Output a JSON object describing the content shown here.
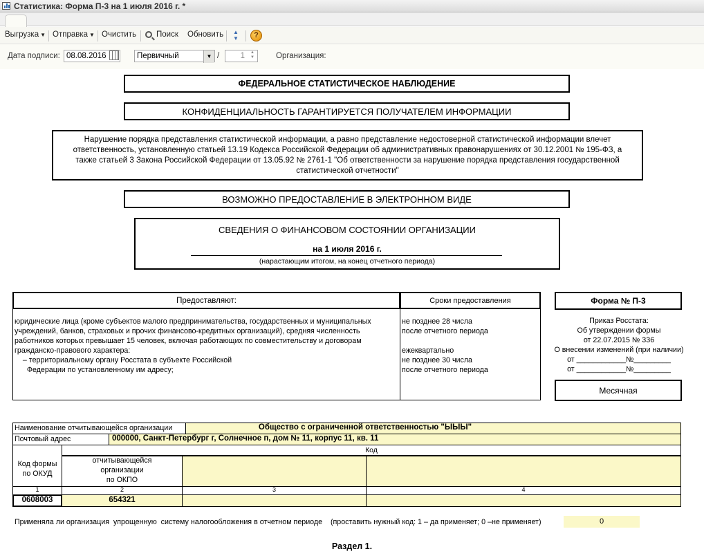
{
  "window": {
    "title": "Статистика: Форма П-3 на 1 июля 2016 г. *"
  },
  "toolbar": {
    "export_label": "Выгрузка",
    "send_label": "Отправка",
    "clear_label": "Очистить",
    "search_label": "Поиск",
    "refresh_label": "Обновить",
    "help_label": "?"
  },
  "params": {
    "sign_date_label": "Дата подписи:",
    "sign_date_value": "08.08.2016",
    "report_type_value": "Первичный",
    "slash": "/",
    "correction_number": "1",
    "organization_label": "Организация:"
  },
  "header": {
    "federal": "ФЕДЕРАЛЬНОЕ СТАТИСТИЧЕСКОЕ НАБЛЮДЕНИЕ",
    "confidential": "КОНФИДЕНЦИАЛЬНОСТЬ ГАРАНТИРУЕТСЯ ПОЛУЧАТЕЛЕМ ИНФОРМАЦИИ",
    "warning_lines": [
      "Нарушение порядка представления статистической информации, а равно представление недостоверной статистической информации влечет",
      "ответственность, установленную статьей 13.19 Кодекса Российской Федерации об административных правонарушениях от 30.12.2001 № 195-ФЗ, а",
      "также статьей 3 Закона Российской Федерации от 13.05.92 № 2761-1 \"Об ответственности за нарушение порядка представления государственной",
      "статистической отчетности\""
    ],
    "electronic": "ВОЗМОЖНО ПРЕДОСТАВЛЕНИЕ В ЭЛЕКТРОННОМ ВИДЕ",
    "report_title": "СВЕДЕНИЯ О ФИНАНСОВОМ СОСТОЯНИИ ОРГАНИЗАЦИИ",
    "report_date": "на 1 июля 2016 г.",
    "report_note": "(нарастающим итогом, на конец отчетного периода)"
  },
  "submitters": {
    "header_who": "Предоставляют:",
    "header_when": "Сроки предоставления",
    "who_lines": [
      "юридические лица (кроме субъектов малого предпринимательства, государственных и муниципальных",
      "учреждений, банков, страховых и прочих финансово-кредитных организаций), средняя численность",
      "работников которых превышает 15 человек, включая работающих по совместительству и договорам",
      "гражданско-правового характера:",
      "    – территориальному органу Росстата в субъекте Российской",
      "      Федерации по установленному им адресу;"
    ],
    "when_lines": [
      "не позднее 28 числа",
      "после отчетного периода",
      "",
      "ежеквартально",
      "не позднее 30 числа",
      "после отчетного периода"
    ]
  },
  "form_info": {
    "form_number": "Форма № П-3",
    "order_lines": [
      "Приказ Росстата:",
      "Об утверждении формы",
      "от 22.07.2015 № 336",
      "О внесении изменений (при наличии)",
      "от ____________№_________",
      "от ____________№_________"
    ],
    "periodicity": "Месячная"
  },
  "org": {
    "name_label": "Наименование отчитывающейся организации",
    "name_value": "Общество с ограниченной ответственностью \"ЫЫЫ\"",
    "address_label": "Почтовый адрес",
    "address_value": "000000, Санкт-Петербург г, Солнечное п, дом № 11, корпус 11, кв. 11"
  },
  "codes": {
    "kod_header": "Код",
    "okud_header_lines": [
      "Код формы",
      "по ОКУД"
    ],
    "okpo_header_lines": [
      "отчитывающейся",
      "организации",
      "по ОКПО"
    ],
    "col_numbers": [
      "1",
      "2",
      "3",
      "4"
    ],
    "okud_value": "0608003",
    "okpo_value": "654321"
  },
  "tax": {
    "question": "Применяла ли организация  упрощенную  систему налогообложения в отчетном периоде    (проставить нужный код: 1 – да применяет; 0 –не применяет)",
    "value": "0"
  },
  "section": {
    "title": "Раздел 1."
  }
}
